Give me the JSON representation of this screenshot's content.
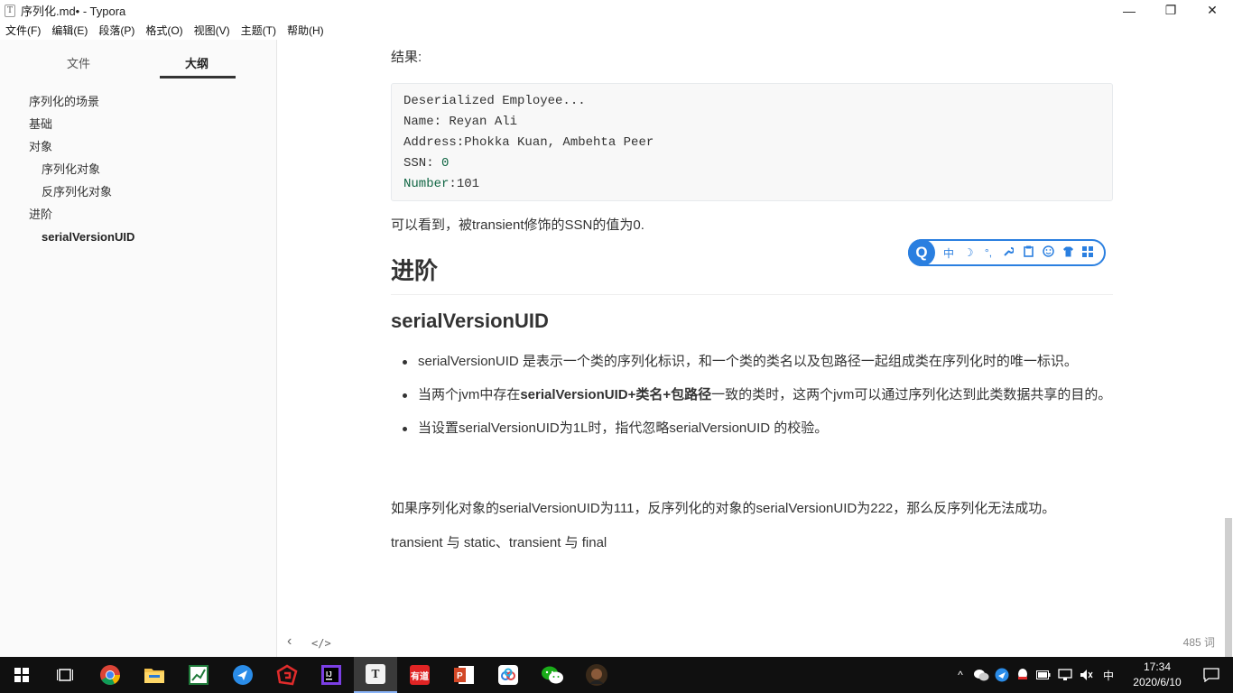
{
  "window": {
    "title": "序列化.md• - Typora",
    "app_icon": "T",
    "controls": [
      "—",
      "❐",
      "✕"
    ]
  },
  "menu": [
    "文件(F)",
    "编辑(E)",
    "段落(P)",
    "格式(O)",
    "视图(V)",
    "主题(T)",
    "帮助(H)"
  ],
  "sidebar": {
    "tabs": {
      "files": "文件",
      "outline": "大纲"
    },
    "outline": [
      {
        "label": "序列化的场景",
        "level": 1
      },
      {
        "label": "基础",
        "level": 1
      },
      {
        "label": "对象",
        "level": 1
      },
      {
        "label": "序列化对象",
        "level": 2
      },
      {
        "label": "反序列化对象",
        "level": 2
      },
      {
        "label": "进阶",
        "level": 1
      },
      {
        "label": "serialVersionUID",
        "level": 2,
        "active": true
      }
    ],
    "bottom": {
      "back": "‹",
      "source": "</>"
    }
  },
  "content": {
    "result_label": "结果:",
    "code_lines": [
      {
        "text": "Deserialized Employee..."
      },
      {
        "text": "Name: Reyan Ali"
      },
      {
        "text": "Address:Phokka Kuan, Ambehta Peer"
      },
      {
        "prefix": "SSN: ",
        "value": "0"
      },
      {
        "prefix": "Number",
        "value": ":101"
      }
    ],
    "after_code": "可以看到，被transient修饰的SSN的值为0.",
    "h2": "进阶",
    "h3": "serialVersionUID",
    "bullets": [
      "serialVersionUID 是表示一个类的序列化标识，和一个类的类名以及包路径一起组成类在序列化时的唯一标识。",
      {
        "before": "当两个jvm中存在",
        "bold": "serialVersionUID+类名+包路径",
        "after": "一致的类时，这两个jvm可以通过序列化达到此类数据共享的目的。"
      },
      "当设置serialVersionUID为1L时，指代忽略serialVersionUID 的校验。"
    ],
    "para1": "如果序列化对象的serialVersionUID为111，反序列化的对象的serialVersionUID为222，那么反序列化无法成功。",
    "para2": "transient 与 static、transient 与 final",
    "word_count": "485 词"
  },
  "ime": {
    "logo": "Q",
    "buttons": [
      "中",
      "☽",
      "°,",
      "🔧",
      "📋",
      "☺",
      "👕",
      "▦"
    ]
  },
  "taskbar": {
    "apps": [
      "start",
      "task-view",
      "chrome",
      "file-explorer",
      "excel",
      "feishu",
      "git",
      "intellij",
      "typora",
      "youdao",
      "powerpoint",
      "baidu-netdisk",
      "wechat",
      "avatar"
    ],
    "tray_icons": [
      "^",
      "wechat",
      "feishu",
      "qq",
      "battery",
      "network",
      "volume",
      "中"
    ],
    "time": "17:34",
    "date": "2020/6/10"
  }
}
